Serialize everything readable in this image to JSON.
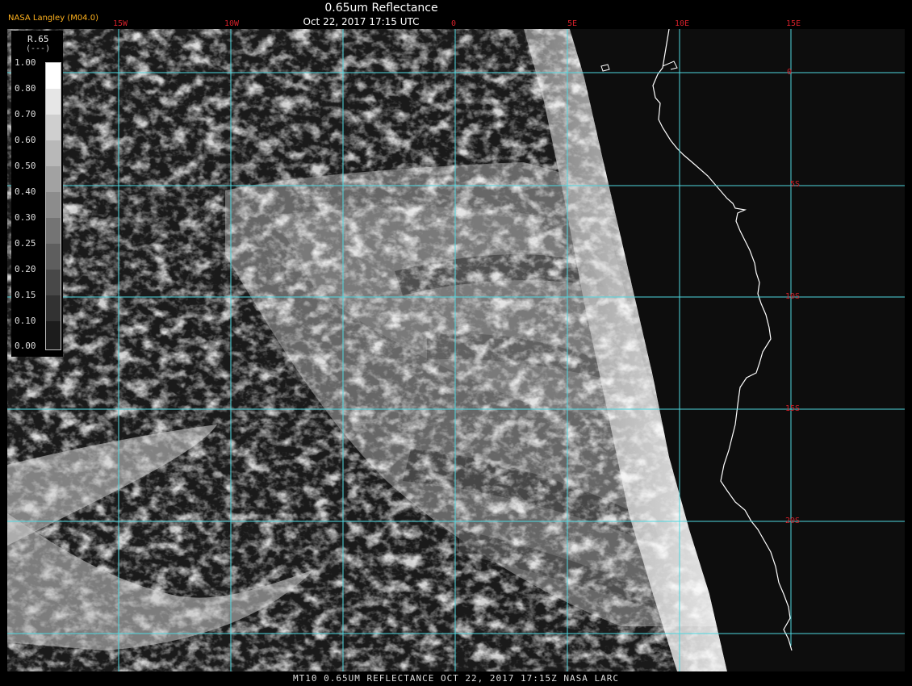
{
  "header": {
    "producer": "NASA Langley (M04.0)",
    "title": "0.65um Reflectance",
    "time": "Oct 22, 2017 17:15 UTC"
  },
  "legend": {
    "label": "R.65",
    "unit": "(---)",
    "ticks": [
      "1.00",
      "0.80",
      "0.70",
      "0.60",
      "0.50",
      "0.40",
      "0.30",
      "0.25",
      "0.20",
      "0.15",
      "0.10",
      "0.00"
    ]
  },
  "grid": {
    "lon_labels": [
      "15W",
      "10W",
      "0",
      "5E",
      "10E",
      "15E"
    ],
    "lat_labels": [
      "0",
      "5S",
      "10S",
      "15S",
      "20S"
    ],
    "color": "#4fd8e0",
    "label_color": "#d3202a"
  },
  "footer": {
    "caption": "MT10  0.65UM REFLECTANCE   OCT 22, 2017 17:15Z   NASA LARC"
  }
}
